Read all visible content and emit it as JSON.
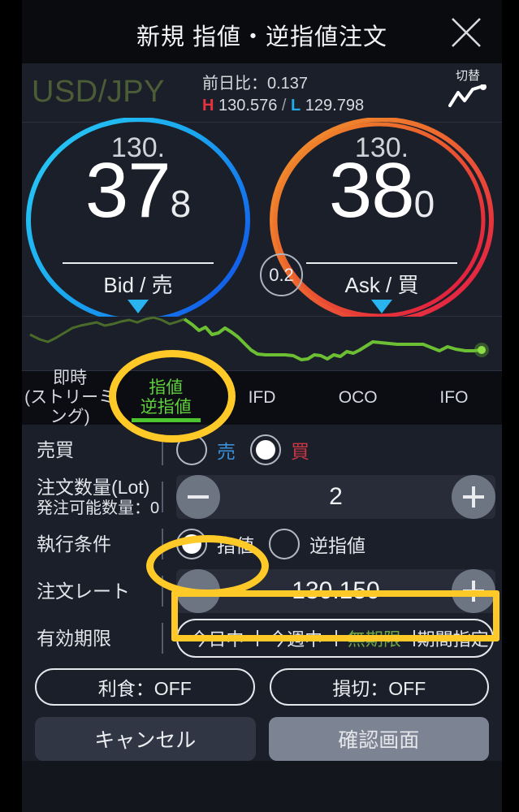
{
  "window": {
    "title": "新規 指値・逆指値注文",
    "close_icon": "close-icon"
  },
  "symbol": {
    "name": "USD/JPY",
    "prev_close_label": "前日比：0.137",
    "high_label": "H",
    "high_value": "130.576",
    "separator": "/",
    "low_label": "L",
    "low_value": "129.798",
    "switch_label": "切替",
    "switch_icon": "chart-line-icon"
  },
  "price": {
    "bid": {
      "integer": "130.",
      "big": "37",
      "small": "8",
      "label": "Bid / 売",
      "arrow_icon": "down-triangle-icon"
    },
    "ask": {
      "integer": "130.",
      "big": "38",
      "small": "0",
      "label": "Ask / 買",
      "arrow_icon": "down-triangle-icon"
    },
    "spread": "0.2"
  },
  "tabs": [
    {
      "line1": "即時",
      "line2": "(ストリーミング)",
      "active": false
    },
    {
      "line1": "指値",
      "line2": "逆指値",
      "active": true
    },
    {
      "line1": "IFD",
      "line2": "",
      "active": false
    },
    {
      "line1": "OCO",
      "line2": "",
      "active": false
    },
    {
      "line1": "IFO",
      "line2": "",
      "active": false
    }
  ],
  "form": {
    "side": {
      "label": "売買",
      "options": [
        {
          "text": "売",
          "selected": false
        },
        {
          "text": "買",
          "selected": true
        }
      ]
    },
    "quantity": {
      "label": "注文数量(Lot)",
      "sublabel": "発注可能数量：0",
      "value": "2",
      "minus_icon": "minus-icon",
      "plus_icon": "plus-icon"
    },
    "condition": {
      "label": "執行条件",
      "options": [
        {
          "text": "指値",
          "selected": true
        },
        {
          "text": "逆指値",
          "selected": false
        }
      ]
    },
    "rate": {
      "label": "注文レート",
      "value": "130.150",
      "minus_icon": "minus-icon",
      "plus_icon": "plus-icon"
    },
    "expiry": {
      "label": "有効期限",
      "options": [
        {
          "text": "今日中",
          "selected": false
        },
        {
          "text": "今週中",
          "selected": false
        },
        {
          "text": "無期限",
          "selected": true
        },
        {
          "text": "期間指定",
          "selected": false
        }
      ]
    },
    "take_profit": "利食：OFF",
    "stop_loss": "損切：OFF"
  },
  "actions": {
    "cancel": "キャンセル",
    "confirm": "確認画面"
  },
  "colors": {
    "accent_green": "#4cc52e",
    "bid_blue": "#22a9e8",
    "ask_red": "#e8323c",
    "annotation_yellow": "#ffc928",
    "background": "#1b1f2a"
  },
  "annotations": [
    {
      "name": "highlight-limit-tab",
      "shape": "ellipse"
    },
    {
      "name": "highlight-limit-radio",
      "shape": "ellipse"
    },
    {
      "name": "highlight-order-rate",
      "shape": "rectangle"
    }
  ]
}
